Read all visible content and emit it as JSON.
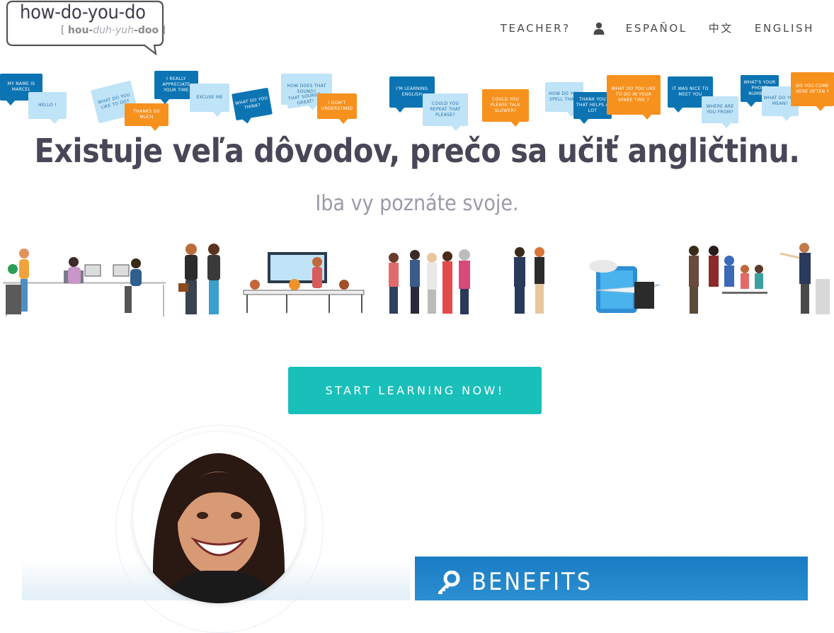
{
  "logo": {
    "main": "how-do-you-do",
    "sub_open": "[ ",
    "sub_a": "hou-",
    "sub_b": "duh-",
    "sub_c": "yuh",
    "sub_d": "-doo",
    "sub_close": " ]"
  },
  "nav": {
    "teacher": "TEACHER?",
    "user_icon": "user-icon",
    "espanol": "ESPAÑOL",
    "chinese": "中文",
    "english": "ENGLISH"
  },
  "bubbles": [
    {
      "text": "MY NAME IS MARCEL",
      "style": "dark"
    },
    {
      "text": "HELLO !",
      "style": "light"
    },
    {
      "text": "WHAT DO YOU LIKE TO DO?",
      "style": "light"
    },
    {
      "text": "THANKS SO MUCH",
      "style": "orange"
    },
    {
      "text": "I REALLY APPRECIATE YOUR TIME",
      "style": "dark"
    },
    {
      "text": "EXCUSE ME",
      "style": "light"
    },
    {
      "text": "WHAT DO YOU THINK?",
      "style": "dark"
    },
    {
      "text": "HOW DOES THAT SOUND?",
      "style": "light"
    },
    {
      "text": "THAT SOUNDS GREAT!",
      "style": "light"
    },
    {
      "text": "I DON'T UNDERSTAND",
      "style": "orange"
    },
    {
      "text": "I'M LEARNING ENGLISH",
      "style": "dark"
    },
    {
      "text": "COULD YOU REPEAT THAT PLEASE?",
      "style": "light"
    },
    {
      "text": "COULD YOU PLEASE TALK SLOWER?",
      "style": "orange"
    },
    {
      "text": "HOW DO YOU SPELL THAT?",
      "style": "light"
    },
    {
      "text": "THANK YOU THAT HELPS A LOT",
      "style": "dark"
    },
    {
      "text": "WHAT DO YOU LIKE TO DO IN YOUR SPARE TIME ?",
      "style": "orange"
    },
    {
      "text": "IT WAS NICE TO MEET YOU",
      "style": "dark"
    },
    {
      "text": "WHERE ARE YOU FROM?",
      "style": "light"
    },
    {
      "text": "WHAT'S YOUR PHONE NUMBER?",
      "style": "dark"
    },
    {
      "text": "WHAT DO YOU MEAN?",
      "style": "light"
    },
    {
      "text": "DO YOU COME HERE OFTEN ?",
      "style": "orange"
    }
  ],
  "hero": {
    "heading": "Existuje veľa dôvodov, prečo sa učiť angličtinu.",
    "subheading": "Iba vy poznáte svoje."
  },
  "cta": {
    "label": "START LEARNING NOW!"
  },
  "benefits": {
    "title": "BENEFITS",
    "icon": "key-icon"
  },
  "colors": {
    "cta": "#19bfb9",
    "bubble_dark": "#0c74b3",
    "bubble_light": "#bfe3f7",
    "bubble_orange": "#f7911e",
    "benefits": "#1a7cc3"
  }
}
